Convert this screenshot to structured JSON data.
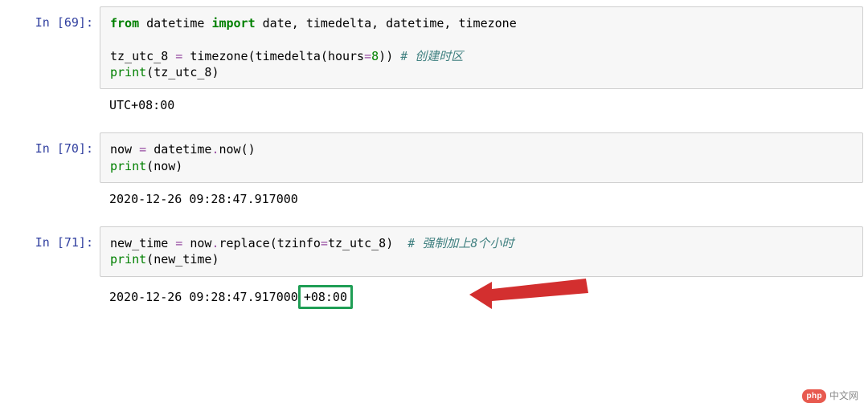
{
  "cells": [
    {
      "prompt": "In [69]:",
      "code": {
        "l1": {
          "kw_from": "from",
          "mod": "datetime",
          "kw_import": "import",
          "names": "date, timedelta, datetime, timezone"
        },
        "blank": " ",
        "l2": {
          "lhs": "tz_utc_8",
          "eq": " = ",
          "t1": "timezone",
          "p1": "(",
          "t2": "timedelta",
          "p2": "(",
          "kw": "hours",
          "eq2": "=",
          "num": "8",
          "p3": ")",
          "p4": ")",
          "cmt": " # 创建时区"
        },
        "l3": {
          "fn": "print",
          "p1": "(",
          "arg": "tz_utc_8",
          "p2": ")"
        }
      },
      "output": "UTC+08:00"
    },
    {
      "prompt": "In [70]:",
      "code": {
        "l1": {
          "lhs": "now",
          "eq": " = ",
          "t1": "datetime",
          "dot": ".",
          "m": "now",
          "p1": "(",
          "p2": ")"
        },
        "l2": {
          "fn": "print",
          "p1": "(",
          "arg": "now",
          "p2": ")"
        }
      },
      "output": "2020-12-26 09:28:47.917000"
    },
    {
      "prompt": "In [71]:",
      "code": {
        "l1": {
          "lhs": "new_time",
          "eq": " = ",
          "t1": "now",
          "dot": ".",
          "m": "replace",
          "p1": "(",
          "kw": "tzinfo",
          "eq2": "=",
          "arg": "tz_utc_8",
          "p2": ")",
          "sp": "  ",
          "cmt": "# 强制加上8个小时"
        },
        "l2": {
          "fn": "print",
          "p1": "(",
          "arg": "new_time",
          "p2": ")"
        }
      },
      "output_pre": "2020-12-26 09:28:47.917000",
      "output_hl": "+08:00"
    }
  ],
  "watermark": {
    "badge": "php",
    "text": "中文网"
  },
  "colors": {
    "keyword": "#008000",
    "comment": "#408080",
    "prompt": "#303F9F",
    "highlight_border": "#1f9e55",
    "arrow": "#d32f2f"
  }
}
